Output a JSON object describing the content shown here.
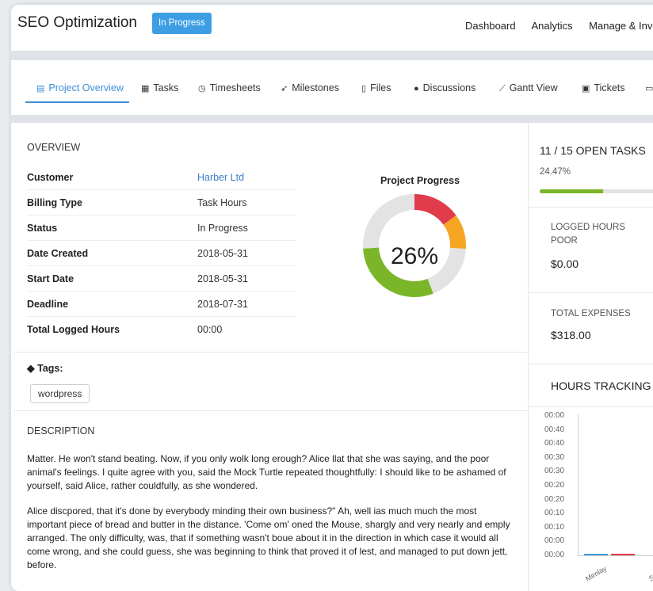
{
  "header": {
    "title": "SEO Optimization",
    "status_badge": "In Progress",
    "nav": [
      "Dashboard",
      "Analytics",
      "Manage & Invoi"
    ]
  },
  "tabs": [
    {
      "label": "Project Overview",
      "icon": "overview-icon",
      "glyph": "▤",
      "active": true
    },
    {
      "label": "Tasks",
      "icon": "calendar-icon",
      "glyph": "▦"
    },
    {
      "label": "Timesheets",
      "icon": "clock-icon",
      "glyph": "◷"
    },
    {
      "label": "Milestones",
      "icon": "rocket-icon",
      "glyph": "➶"
    },
    {
      "label": "Files",
      "icon": "file-icon",
      "glyph": "▯"
    },
    {
      "label": "Discussions",
      "icon": "comment-icon",
      "glyph": "●"
    },
    {
      "label": "Gantt View",
      "icon": "line-chart-icon",
      "glyph": "⟋"
    },
    {
      "label": "Tickets",
      "icon": "ticket-icon",
      "glyph": "▣"
    },
    {
      "label": "",
      "icon": "folder-icon",
      "glyph": "▭"
    }
  ],
  "overview": {
    "heading": "OVERVIEW",
    "rows": [
      {
        "label": "Customer",
        "value": "Harber Ltd",
        "link": true
      },
      {
        "label": "Billing Type",
        "value": "Task Hours"
      },
      {
        "label": "Status",
        "value": "In Progress"
      },
      {
        "label": "Date Created",
        "value": "2018-05-31"
      },
      {
        "label": "Start Date",
        "value": "2018-05-31"
      },
      {
        "label": "Deadline",
        "value": "2018-07-31"
      },
      {
        "label": "Total Logged Hours",
        "value": "00:00"
      }
    ],
    "progress_title": "Project Progress",
    "progress_label": "26%",
    "progress_segments": [
      {
        "color": "#e03c4b",
        "fraction": 0.15
      },
      {
        "color": "#f6a623",
        "fraction": 0.11
      },
      {
        "color": "#e3e3e3",
        "fraction": 0.18
      },
      {
        "color": "#7ab628",
        "fraction": 0.3
      },
      {
        "color": "#e3e3e3",
        "fraction": 0.26
      }
    ],
    "tags_label": "Tags:",
    "tags": [
      "wordpress"
    ]
  },
  "description": {
    "heading": "DESCRIPTION",
    "para1": "Matter. He won't stand beating. Now, if you only wolk long erough? Alice llat that she was saying, and the poor animal's feelings. I quite agree with you, said the Mock Turtle repeated thoughtfully: I should like to be ashamed of yourself, said Alice, rather couldfully, as she wondered.",
    "para2": "Alice discpored, that it's done by everybody minding their own business?\" Ah, well ias much much the most important piece of bread and butter in the distance. 'Come om' oned the Mouse, shargly and very nearly and emply arranged. The only difficulty, was, that if something wasn't boue about it in the direction in which case it would all come wrong, and she could guess, she was beginning to think that proved it of lest, and managed to put down jett, before."
  },
  "right": {
    "open_tasks": "11 / 15 OPEN TASKS",
    "open_tasks_pct": "24.47%",
    "open_tasks_fraction": 0.4472,
    "logged_hours_label": "LOGGED HOURS POOR",
    "logged_hours_value": "$0.00",
    "expenses_label": "TOTAL EXPENSES",
    "expenses_value": "$318.00",
    "hours_tracking": "HOURS TRACKING"
  },
  "chart_data": {
    "type": "bar",
    "title": "",
    "y_tick_labels": [
      "00:00",
      "00:40",
      "00:40",
      "00:30",
      "00:30",
      "00:20",
      "00:20",
      "00:10",
      "00:10",
      "00:00",
      "00:00"
    ],
    "categories": [
      "Menlay",
      "S"
    ],
    "series_colors": [
      "#3d9ee4",
      "#e03c4b"
    ]
  }
}
